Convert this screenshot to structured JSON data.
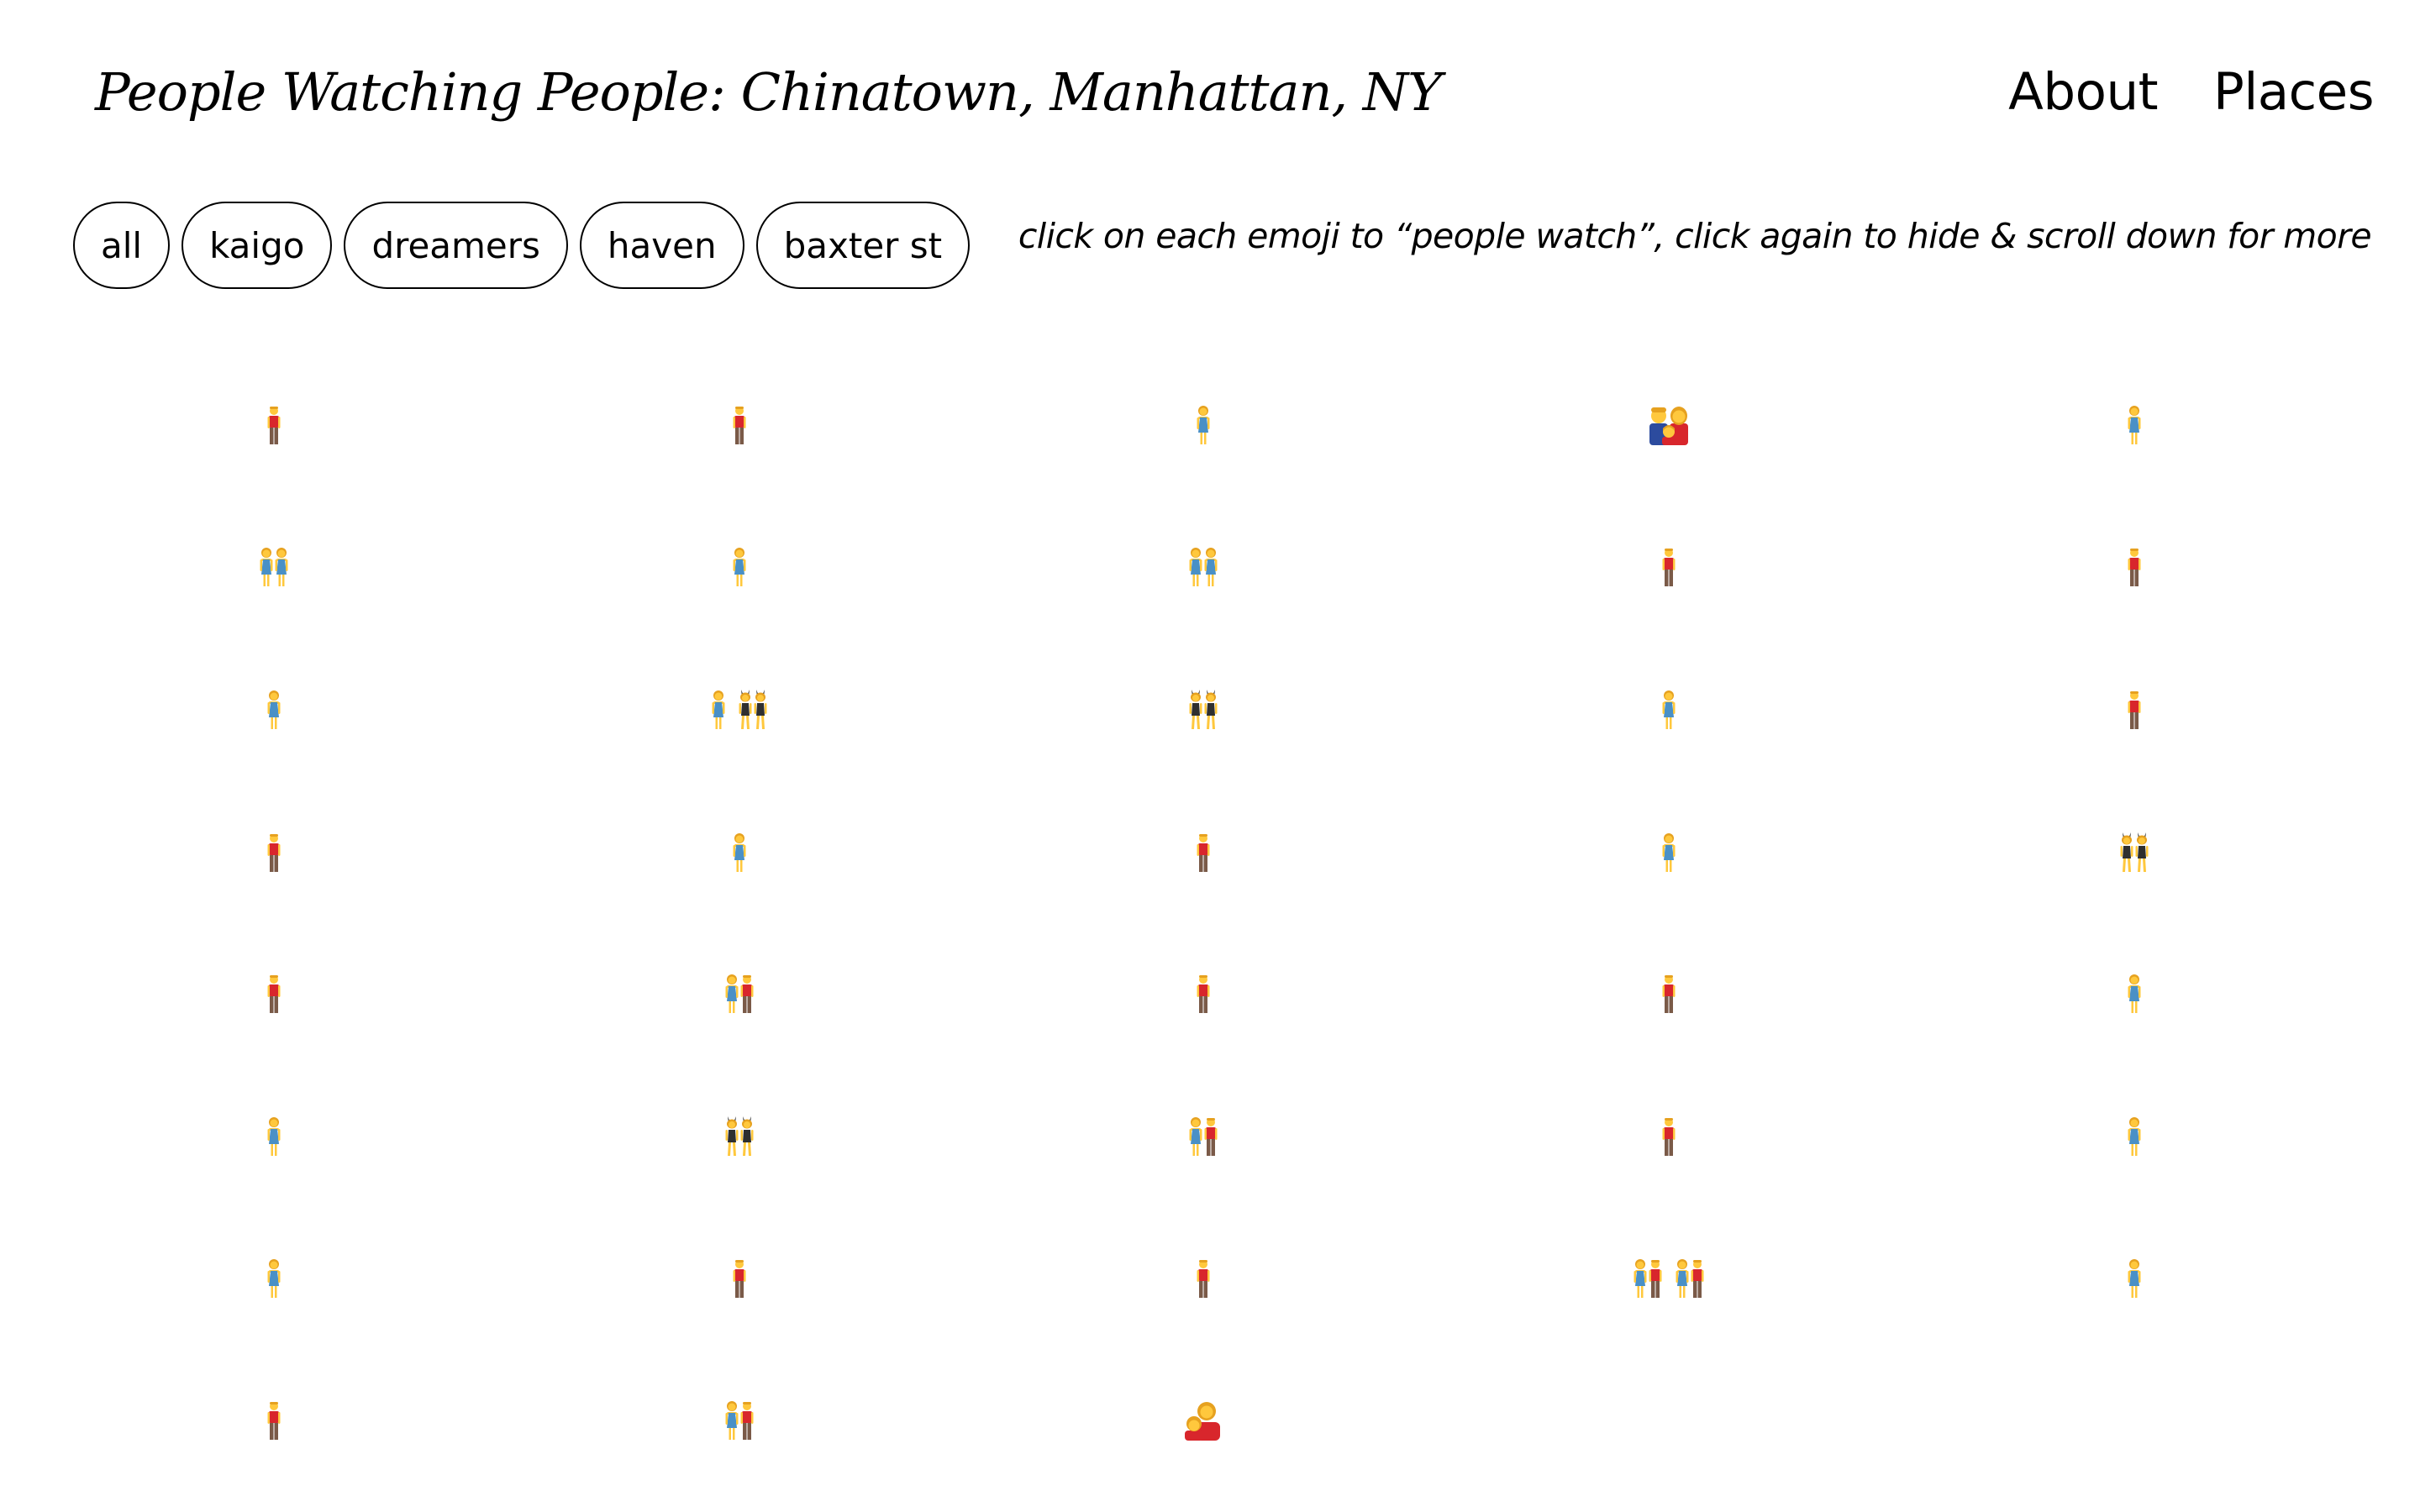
{
  "header": {
    "title": "People Watching People: Chinatown, Manhattan, NY",
    "nav": [
      "About",
      "Places"
    ]
  },
  "filters": [
    "all",
    "kaigo",
    "dreamers",
    "haven",
    "baxter st"
  ],
  "instruction": "click on each emoji to “people watch”, click again to hide & scroll down for more",
  "emoji_grid": {
    "columns": 5,
    "rows": [
      [
        "man",
        "man",
        "woman",
        "family",
        "woman"
      ],
      [
        "two-women",
        "woman",
        "two-women",
        "man",
        "man"
      ],
      [
        "woman",
        "woman-and-bunny-pair",
        "bunny-ears-pair",
        "woman",
        "man"
      ],
      [
        "man",
        "woman",
        "man",
        "woman",
        "bunny-ears-pair"
      ],
      [
        "man",
        "woman-and-man",
        "man",
        "man",
        "woman"
      ],
      [
        "woman",
        "bunny-ears-pair",
        "woman-and-man",
        "man",
        "woman"
      ],
      [
        "woman",
        "man",
        "man",
        "two-couples",
        "woman"
      ],
      [
        "man",
        "woman-and-man",
        "woman-with-child",
        null,
        null
      ]
    ]
  },
  "colors": {
    "background": "#ffffff",
    "text": "#000000",
    "skin": "#FFC83D",
    "hair": "#E6A11F",
    "woman_dress": "#4A90C6",
    "man_shirt": "#D8262C",
    "man_pants": "#7A5A48",
    "bunny_suit": "#2F2F2F",
    "family_blue": "#2C4B9E"
  }
}
